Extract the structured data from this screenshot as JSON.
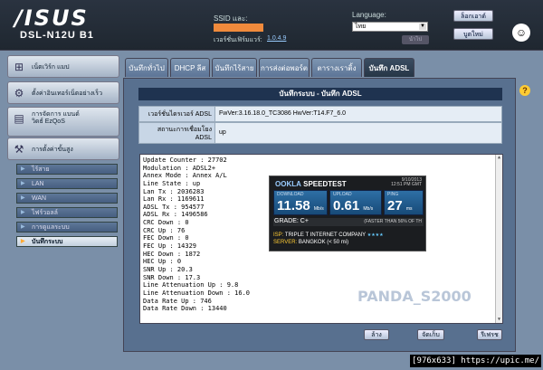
{
  "header": {
    "brand": "/ISUS",
    "model": "DSL-N12U B1",
    "ssid_label": "SSID และ:",
    "firmware_label": "เวอร์ชั่นเฟิร์มแวร์:",
    "firmware_version": "1.0.4.9",
    "language_label": "Language:",
    "language_value": "ไทย",
    "apply_label": "นำไป",
    "logout_label": "ล็อกเอาต์",
    "reboot_label": "บูตใหม่",
    "avatar_icon": "face-icon"
  },
  "sidebar": {
    "main_items": [
      {
        "label": "เน็ตเวิร์ก แมป",
        "icon": "network-map-icon"
      },
      {
        "label": "ตั้งค่าอินเทอร์เน็ตอย่างเร็ว",
        "icon": "quick-setup-icon"
      },
      {
        "label": "การจัดการ แบนด์วิดธ์ EzQoS",
        "icon": "qos-icon"
      },
      {
        "label": "การตั้งค่าขั้นสูง",
        "icon": "advanced-settings-icon"
      }
    ],
    "sub_items": [
      {
        "label": "ไร้สาย"
      },
      {
        "label": "LAN"
      },
      {
        "label": "WAN"
      },
      {
        "label": "ไฟร์วอลล์"
      },
      {
        "label": "การดูแลระบบ"
      },
      {
        "label": "บันทึกระบบ"
      }
    ]
  },
  "tabs": [
    {
      "label": "บันทึกทั่วไป"
    },
    {
      "label": "DHCP ลีส"
    },
    {
      "label": "บันทึกไร้สาย"
    },
    {
      "label": "การส่งต่อพอร์ต"
    },
    {
      "label": "ตารางเราติ้ง"
    },
    {
      "label": "บันทึก ADSL"
    }
  ],
  "panel": {
    "title": "บันทึกระบบ - บันทึก ADSL",
    "fw_label": "เวอร์ชั่นไดรเวอร์ ADSL",
    "fw_value": "FwVer:3.16.18.0_TC3086 HwVer:T14.F7_6.0",
    "status_label": "สถานะการเชื่อมโยง ADSL",
    "status_value": "up",
    "log_lines": [
      "Update Counter : 27702",
      "Modulation : ADSL2+",
      "Annex Mode : Annex A/L",
      "Line State : up",
      "Lan Tx : 2036283",
      "Lan Rx : 1169611",
      "ADSL Tx : 954577",
      "ADSL Rx : 1496586",
      "CRC Down : 0",
      "CRC Up : 76",
      "FEC Down : 0",
      "FEC Up : 14329",
      "HEC Down : 1872",
      "HEC Up : 0",
      "SNR Up : 20.3",
      "SNR Down : 17.3",
      "Line Attenuation Up : 9.8",
      "Line Attenuation Down : 16.0",
      "Data Rate Up : 746",
      "Data Rate Down : 13440"
    ],
    "watermark": "PANDA_S2000",
    "buttons": {
      "clear": "ล้าง",
      "save": "จัดเก็บ",
      "refresh": "รีเฟรช"
    }
  },
  "speedtest": {
    "logo": "OOKLA",
    "product": "SPEEDTEST",
    "date": "9/10/2013",
    "time": "12:51 PM GMT",
    "download_label": "DOWNLOAD",
    "download_value": "11.58",
    "download_unit": "Mb/s",
    "upload_label": "UPLOAD",
    "upload_value": "0.61",
    "upload_unit": "Mb/s",
    "ping_label": "PING",
    "ping_value": "27",
    "ping_unit": "ms",
    "grade": "GRADE: C+",
    "faster_than": "(FASTER THAN 56% OF TH",
    "isp_label": "ISP:",
    "isp_value": "TRIPLE T INTERNET COMPANY",
    "isp_stars": "★★★★",
    "server_label": "SERVER:",
    "server_value": "BANGKOK (< 50 mi)"
  },
  "credit": "[976x633] https://upic.me/"
}
